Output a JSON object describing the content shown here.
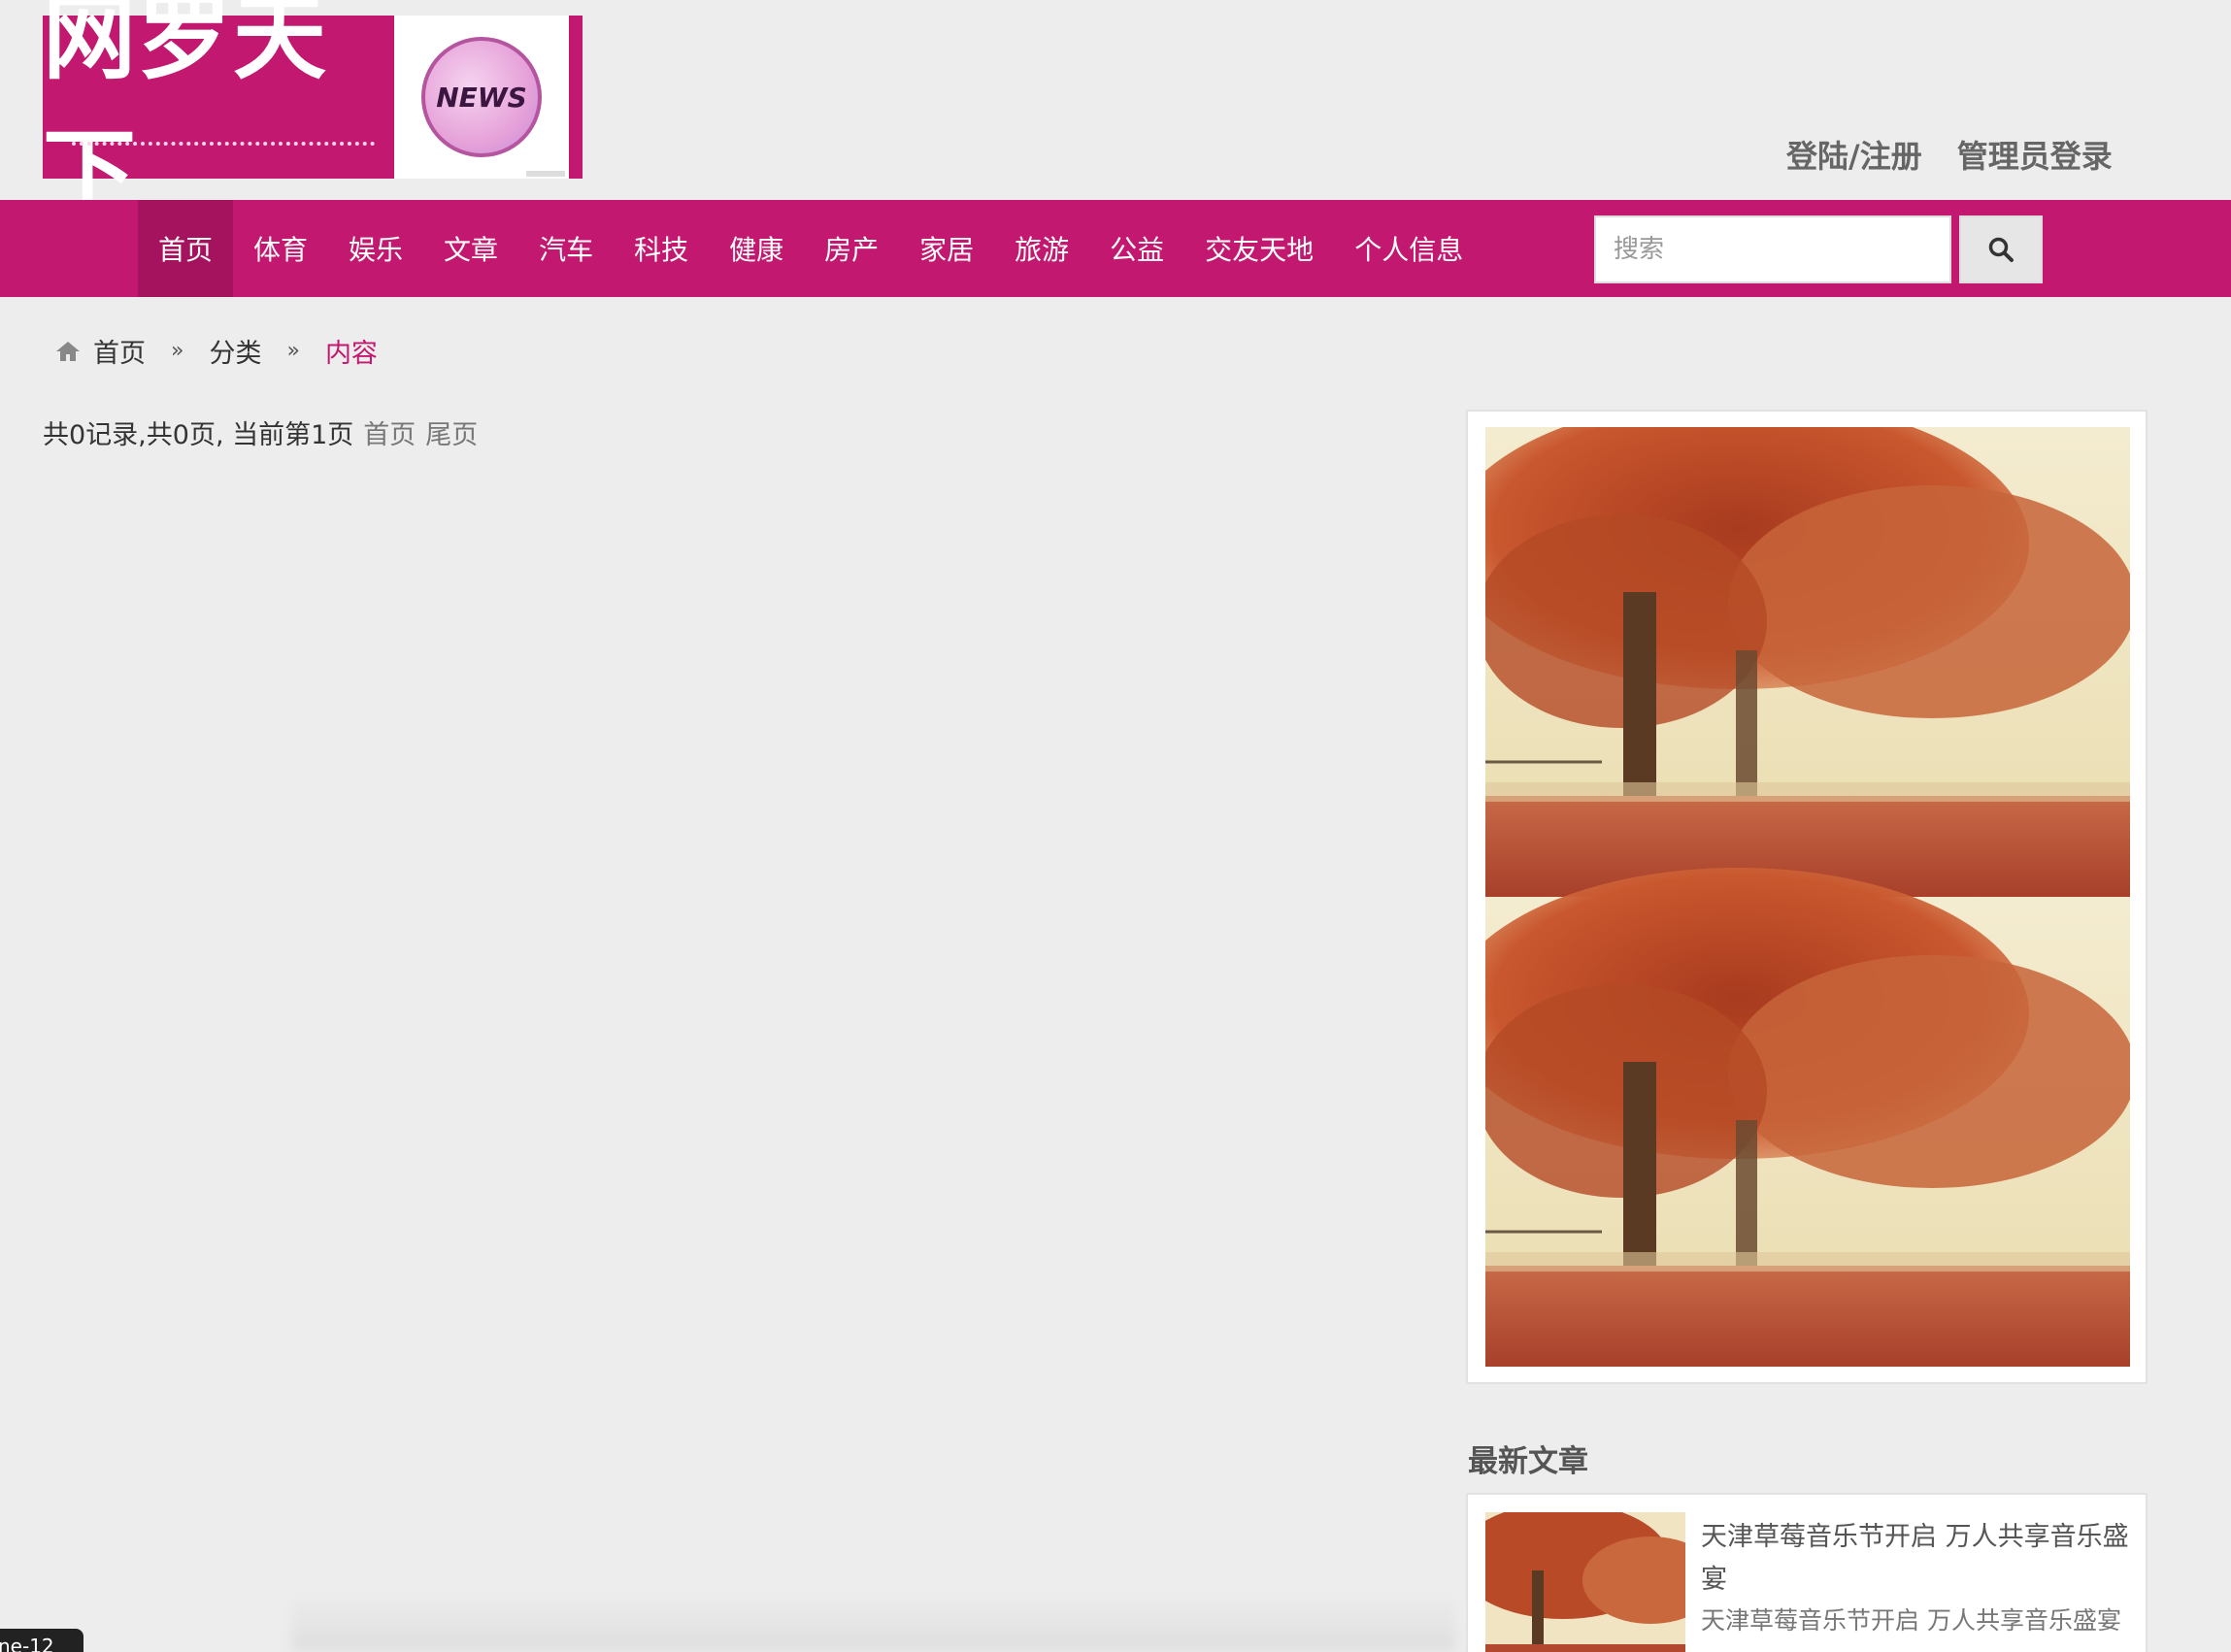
{
  "header": {
    "logo_text": "网罗天下",
    "logo_badge": "NEWS",
    "auth_links": [
      "登陆/注册",
      "管理员登录"
    ]
  },
  "nav": {
    "items": [
      {
        "label": "首页",
        "active": true
      },
      {
        "label": "体育"
      },
      {
        "label": "娱乐"
      },
      {
        "label": "文章"
      },
      {
        "label": "汽车"
      },
      {
        "label": "科技"
      },
      {
        "label": "健康"
      },
      {
        "label": "房产"
      },
      {
        "label": "家居"
      },
      {
        "label": "旅游"
      },
      {
        "label": "公益"
      },
      {
        "label": "交友天地"
      },
      {
        "label": "个人信息"
      }
    ],
    "search_placeholder": "搜索",
    "search_icon": "search-icon"
  },
  "breadcrumb": {
    "home_icon": "home-icon",
    "items": [
      "首页",
      "分类",
      "内容"
    ],
    "separator": "»"
  },
  "pagination": {
    "summary": "共0记录,共0页, 当前第1页",
    "first_label": "首页",
    "last_label": "尾页"
  },
  "sidebar": {
    "latest_title": "最新文章",
    "latest_items": [
      {
        "title": "天津草莓音乐节开启 万人共享音乐盛宴",
        "summary": "天津草莓音乐节开启 万人共享音乐盛宴"
      }
    ]
  },
  "overlay": {
    "corner_tag": "ne-12"
  },
  "colors": {
    "brand": "#c2186f",
    "nav_active": "#a5125e",
    "background": "#ededed"
  }
}
